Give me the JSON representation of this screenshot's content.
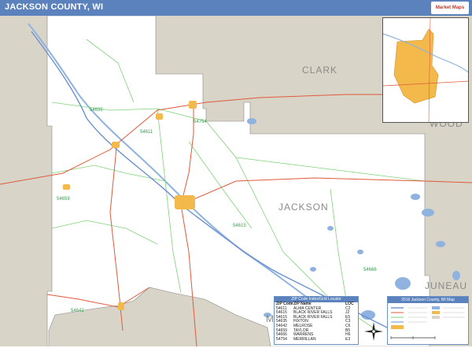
{
  "header": {
    "title": "JACKSON COUNTY, WI",
    "logo_text": "Market Maps"
  },
  "map": {
    "county_labels": [
      "CLARK",
      "WOOD",
      "JACKSON",
      "JUNEAU",
      "M"
    ],
    "zip_labels": [
      "54635",
      "54754",
      "54611",
      "54659",
      "54615",
      "54642",
      "54666"
    ],
    "colors": {
      "surrounding": "#d9d4c8",
      "county": "#ffffff",
      "city": "#f3b94a",
      "zip_boundary": "#7fd17a",
      "road": "#e05a3a",
      "water": "#8fb3de",
      "header": "#5b82bd"
    }
  },
  "zip_index": {
    "title": "ZIP Code Index/Grid Locator",
    "columns": [
      "ZIP Code",
      "ZIP Name",
      "LOC"
    ],
    "rows": [
      [
        "54611",
        "ALMA CENTER",
        "C2"
      ],
      [
        "54615",
        "BLACK RIVER FALLS",
        "J2"
      ],
      [
        "54615",
        "BLACK RIVER FALLS",
        "E5"
      ],
      [
        "54635",
        "HIXTON",
        "C3"
      ],
      [
        "54642",
        "MELROSE",
        "C6"
      ],
      [
        "54659",
        "TAYLOR",
        "B5"
      ],
      [
        "54666",
        "WARRENS",
        "H6"
      ],
      [
        "54754",
        "MERRILLAN",
        "E3"
      ]
    ]
  },
  "legend": {
    "title": "2016 Jackson County, WI Map"
  }
}
